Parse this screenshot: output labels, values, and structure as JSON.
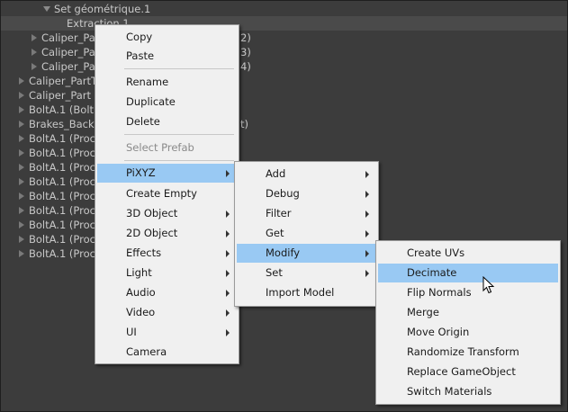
{
  "hierarchy": {
    "parent": "Set géométrique.1",
    "selected": "Extraction.1",
    "rows": [
      {
        "label": "Caliper_Pa",
        "tail": "2)"
      },
      {
        "label": "Caliper_Pa",
        "tail": "3)"
      },
      {
        "label": "Caliper_Pa",
        "tail": "4)"
      },
      {
        "label": "Caliper_PartT",
        "tail": ""
      },
      {
        "label": "Caliper_Part",
        "tail": ""
      },
      {
        "label": "BoltA.1 (Bolt",
        "tail": ""
      },
      {
        "label": "Brakes_Back",
        "tail": "t)"
      },
      {
        "label": "BoltA.1 (Proc",
        "tail": ""
      },
      {
        "label": "BoltA.1 (Proc",
        "tail": ""
      },
      {
        "label": "BoltA.1 (Proc",
        "tail": ""
      },
      {
        "label": "BoltA.1 (Proc",
        "tail": ""
      },
      {
        "label": "BoltA.1 (Proc",
        "tail": ""
      },
      {
        "label": "BoltA.1 (Proc",
        "tail": ""
      },
      {
        "label": "BoltA.1 (Proc",
        "tail": ""
      },
      {
        "label": "BoltA.1 (Proc",
        "tail": ""
      },
      {
        "label": "BoltA.1 (Proc",
        "tail": ""
      }
    ]
  },
  "context_menu": {
    "items": [
      "Copy",
      "Paste",
      "Rename",
      "Duplicate",
      "Delete",
      "Select Prefab",
      "PiXYZ",
      "Create Empty",
      "3D Object",
      "2D Object",
      "Effects",
      "Light",
      "Audio",
      "Video",
      "UI",
      "Camera"
    ]
  },
  "pixyz_menu": {
    "items": [
      "Add",
      "Debug",
      "Filter",
      "Get",
      "Modify",
      "Set",
      "Import Model"
    ]
  },
  "modify_menu": {
    "items": [
      "Create UVs",
      "Decimate",
      "Flip Normals",
      "Merge",
      "Move Origin",
      "Randomize Transform",
      "Replace GameObject",
      "Switch Materials"
    ]
  },
  "colors": {
    "highlight": "#99c9f3",
    "menu_bg": "#f0f0f0",
    "panel_bg": "#3c3c3c"
  }
}
